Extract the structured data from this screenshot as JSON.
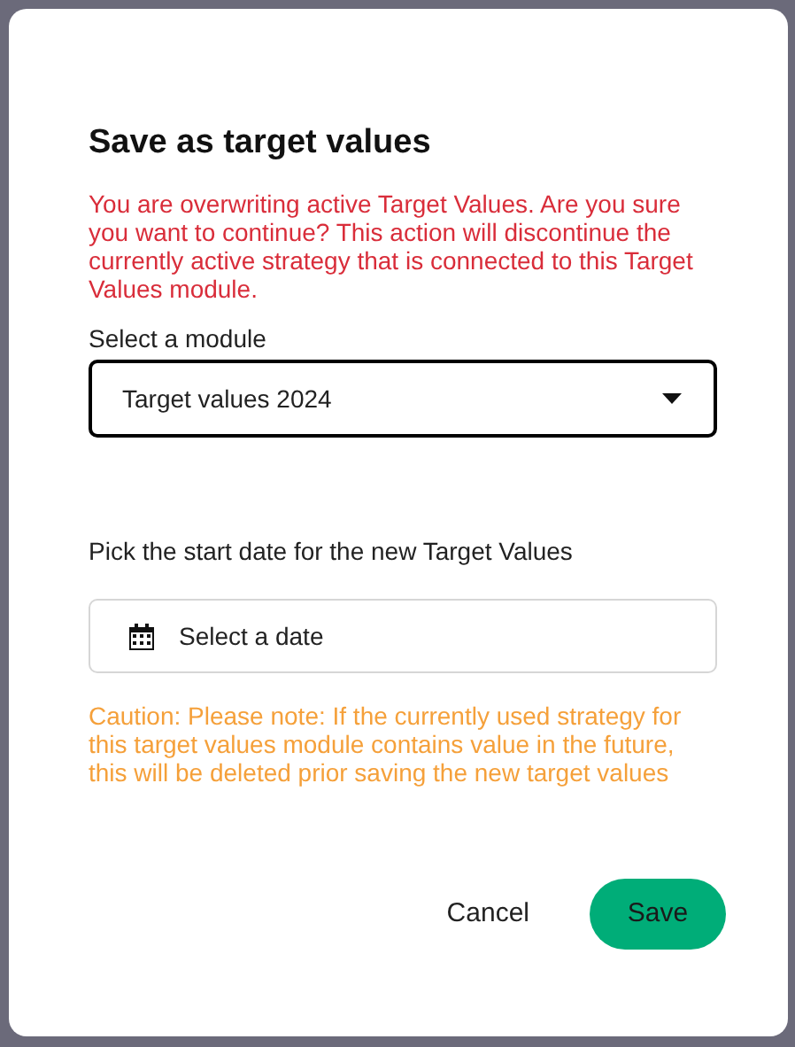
{
  "dialog": {
    "title": "Save as target values",
    "warning": "You are overwriting active Target Values. Are you sure you want to continue? This action will discontinue the currently active strategy that is connected to this Target Values module.",
    "module_select": {
      "label": "Select a module",
      "value": "Target values 2024"
    },
    "date_field": {
      "label": "Pick the start date for the new Target Values",
      "placeholder": "Select a date"
    },
    "caution": "Caution: Please note: If the currently used strategy for this target values module contains value in the future, this will be deleted prior saving the new target values",
    "buttons": [
      {
        "kind": "text",
        "label": "Cancel"
      },
      {
        "kind": "primary",
        "label": "Save"
      }
    ]
  }
}
